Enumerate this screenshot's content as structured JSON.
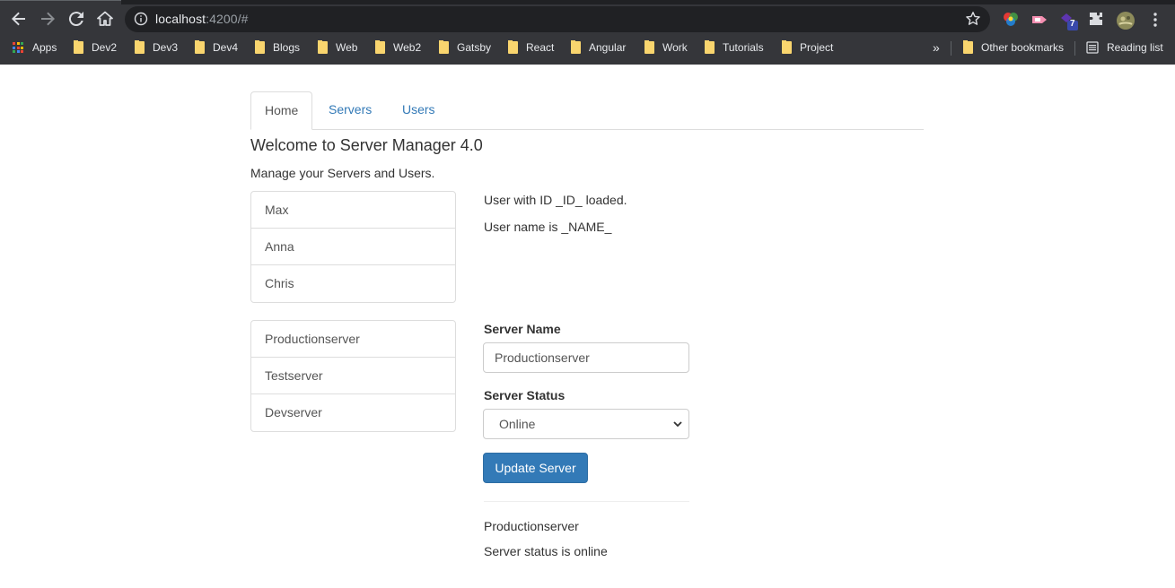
{
  "browser": {
    "url_host": "localhost",
    "url_rest": ":4200/#",
    "extension_badge": "7",
    "bookmarks": [
      {
        "label": "Apps",
        "type": "apps"
      },
      {
        "label": "Dev2"
      },
      {
        "label": "Dev3"
      },
      {
        "label": "Dev4"
      },
      {
        "label": "Blogs"
      },
      {
        "label": "Web"
      },
      {
        "label": "Web2"
      },
      {
        "label": "Gatsby"
      },
      {
        "label": "React"
      },
      {
        "label": "Angular"
      },
      {
        "label": "Work"
      },
      {
        "label": "Tutorials"
      },
      {
        "label": "Project"
      }
    ],
    "overflow_label": "»",
    "other_bookmarks": "Other bookmarks",
    "reading_list": "Reading list"
  },
  "app": {
    "tabs": [
      {
        "label": "Home",
        "active": true
      },
      {
        "label": "Servers",
        "active": false
      },
      {
        "label": "Users",
        "active": false
      }
    ],
    "title": "Welcome to Server Manager 4.0",
    "subtitle": "Manage your Servers and Users.",
    "users": [
      "Max",
      "Anna",
      "Chris"
    ],
    "servers": [
      "Productionserver",
      "Testserver",
      "Devserver"
    ],
    "user_info": {
      "loaded": "User with ID _ID_ loaded.",
      "name": "User name is _NAME_"
    },
    "edit_server": {
      "name_label": "Server Name",
      "name_value": "Productionserver",
      "status_label": "Server Status",
      "status_value": "Online",
      "update_button": "Update Server"
    },
    "server_detail": {
      "name": "Productionserver",
      "status": "Server status is online"
    }
  },
  "colors": {
    "primary": "#337ab7",
    "chrome_bg": "#35363a",
    "omnibox_bg": "#202124"
  }
}
